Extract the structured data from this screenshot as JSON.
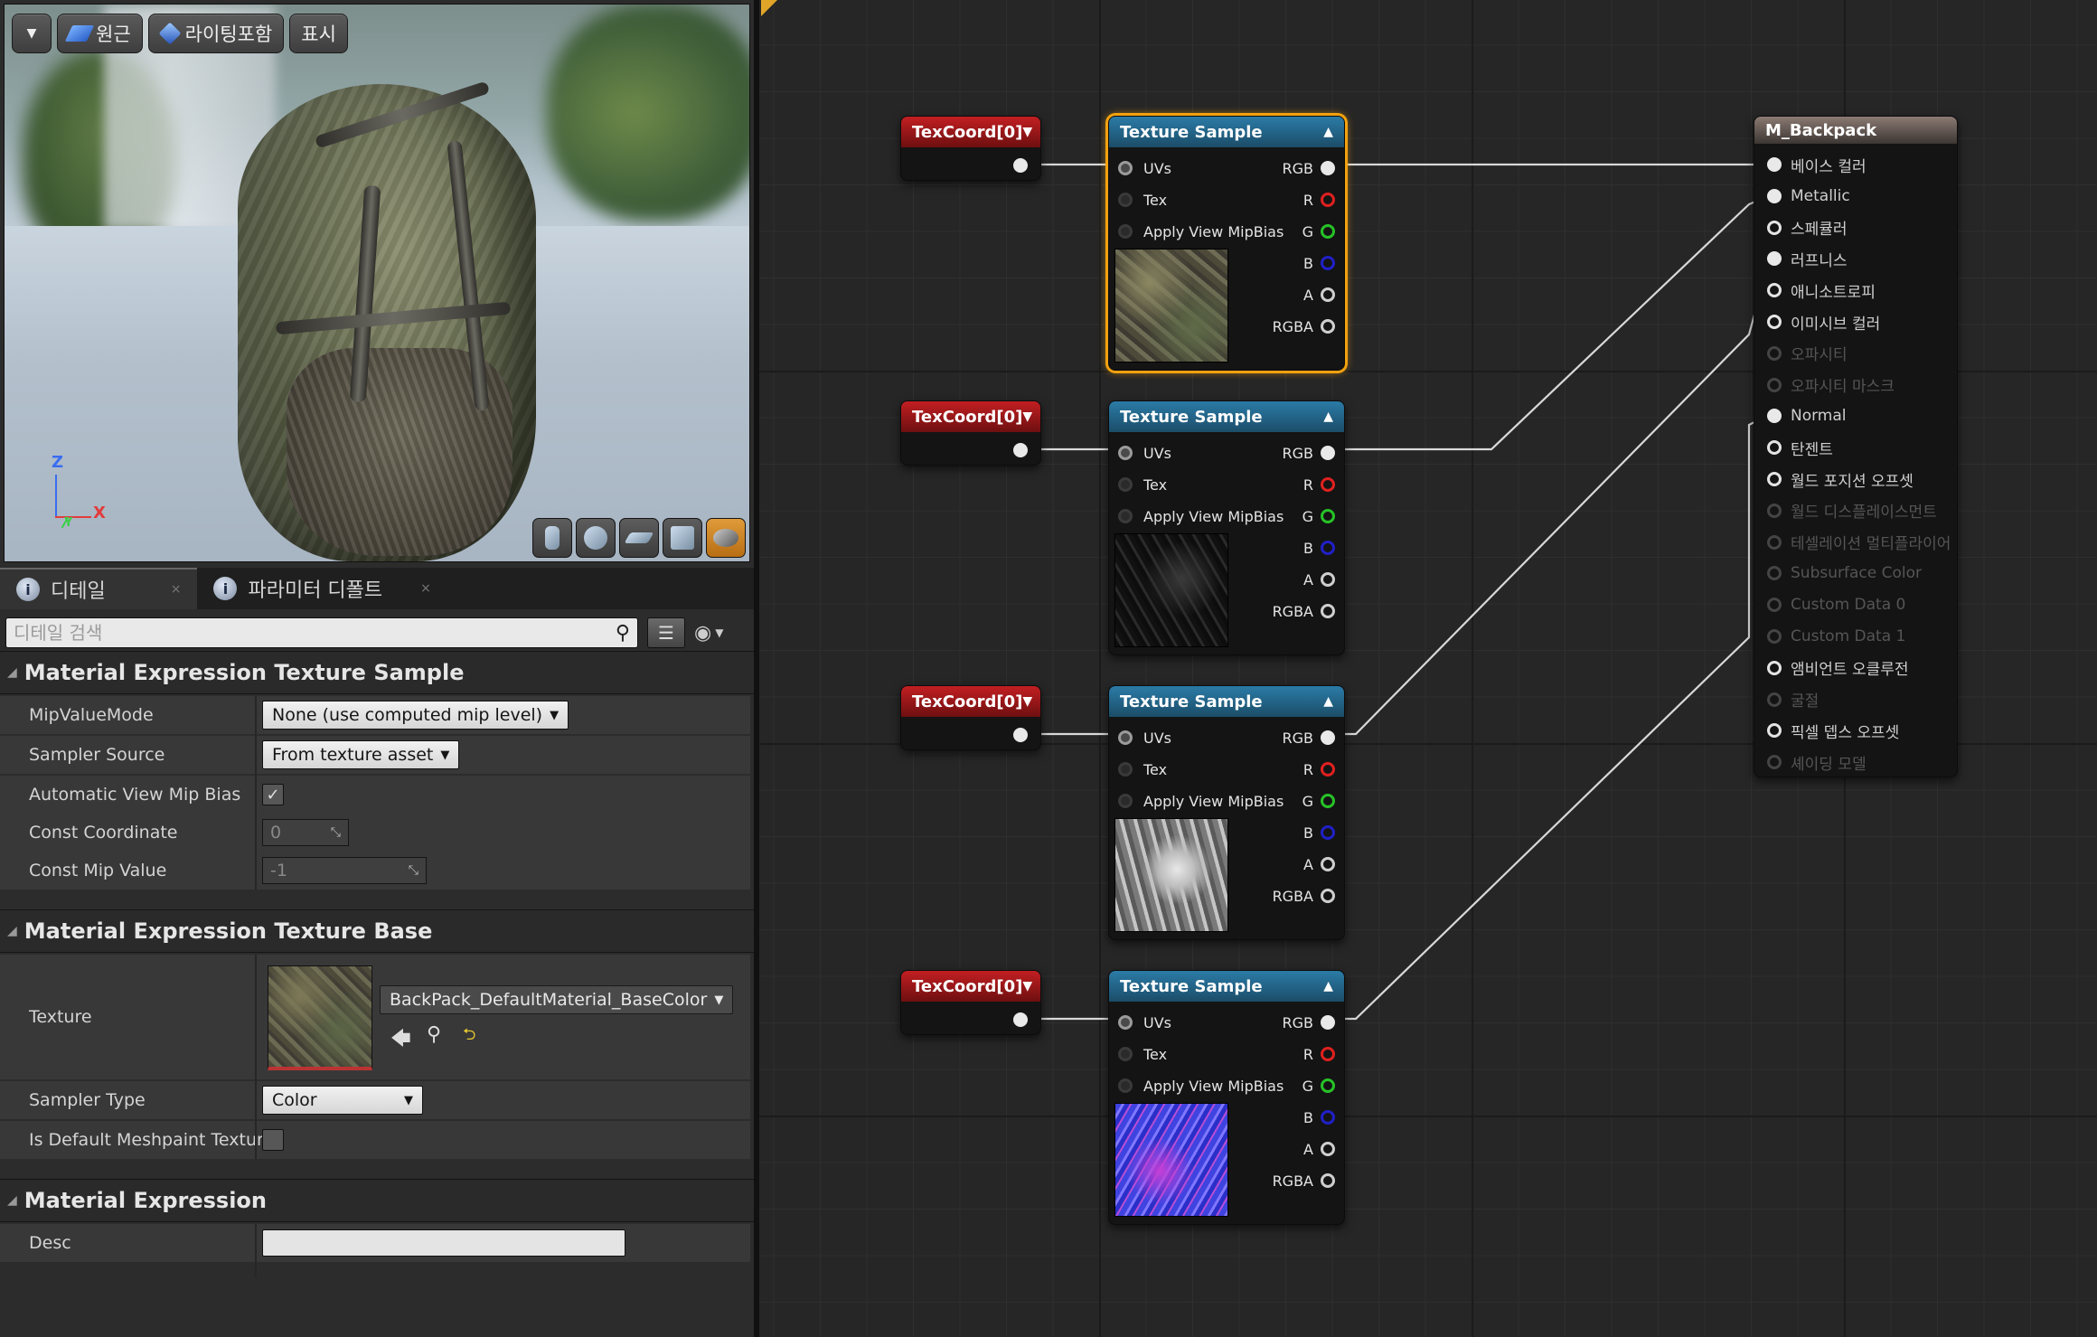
{
  "viewport": {
    "toolbar": {
      "menu_icon": "chevron-down-icon",
      "perspective_label": "원근",
      "lighting_label": "라이팅포함",
      "show_label": "표시"
    },
    "axes": {
      "z": "Z",
      "x": "X",
      "y": "Y"
    },
    "preview_tools": [
      "cylinder-icon",
      "sphere-icon",
      "plane-icon",
      "cube-icon",
      "teapot-icon"
    ]
  },
  "tabs": [
    {
      "label": "디테일",
      "icon": "info-icon",
      "active": true
    },
    {
      "label": "파라미터 디폴트",
      "icon": "info-icon",
      "active": false
    }
  ],
  "details": {
    "search_placeholder": "디테일 검색",
    "sections": {
      "texture_sample": {
        "title": "Material Expression Texture Sample",
        "mip_value_mode_label": "MipValueMode",
        "mip_value_mode_value": "None (use computed mip level)",
        "sampler_source_label": "Sampler Source",
        "sampler_source_value": "From texture asset",
        "auto_view_mip_bias_label": "Automatic View Mip Bias",
        "auto_view_mip_bias_checked": true,
        "const_coordinate_label": "Const Coordinate",
        "const_coordinate_value": "0",
        "const_mip_value_label": "Const Mip Value",
        "const_mip_value_value": "-1"
      },
      "texture_base": {
        "title": "Material Expression Texture Base",
        "texture_label": "Texture",
        "texture_asset": "BackPack_DefaultMaterial_BaseColor",
        "sampler_type_label": "Sampler Type",
        "sampler_type_value": "Color",
        "is_default_meshpaint_label": "Is Default Meshpaint Texture",
        "is_default_meshpaint_checked": false
      },
      "material_expression": {
        "title": "Material Expression",
        "desc_label": "Desc",
        "desc_value": ""
      }
    }
  },
  "graph": {
    "texcoord_label": "TexCoord[0]",
    "texture_sample_title": "Texture Sample",
    "texture_sample_pins": {
      "inputs": [
        "UVs",
        "Tex",
        "Apply View MipBias"
      ],
      "outputs": [
        "RGB",
        "R",
        "G",
        "B",
        "A",
        "RGBA"
      ]
    },
    "texture_samples": [
      {
        "preview": "base-color",
        "selected": true
      },
      {
        "preview": "metallic",
        "selected": false
      },
      {
        "preview": "roughness",
        "selected": false
      },
      {
        "preview": "normal",
        "selected": false
      }
    ],
    "material_node": {
      "title": "M_Backpack",
      "inputs": [
        {
          "label": "베이스 컬러",
          "enabled": true,
          "connected": true
        },
        {
          "label": "Metallic",
          "enabled": true,
          "connected": true
        },
        {
          "label": "스페큘러",
          "enabled": true,
          "connected": false
        },
        {
          "label": "러프니스",
          "enabled": true,
          "connected": true
        },
        {
          "label": "애니소트로피",
          "enabled": true,
          "connected": false
        },
        {
          "label": "이미시브 컬러",
          "enabled": true,
          "connected": false
        },
        {
          "label": "오파시티",
          "enabled": false,
          "connected": false
        },
        {
          "label": "오파시티 마스크",
          "enabled": false,
          "connected": false
        },
        {
          "label": "Normal",
          "enabled": true,
          "connected": true
        },
        {
          "label": "탄젠트",
          "enabled": true,
          "connected": false
        },
        {
          "label": "월드 포지션 오프셋",
          "enabled": true,
          "connected": false
        },
        {
          "label": "월드 디스플레이스먼트",
          "enabled": false,
          "connected": false
        },
        {
          "label": "테셀레이션 멀티플라이어",
          "enabled": false,
          "connected": false
        },
        {
          "label": "Subsurface Color",
          "enabled": false,
          "connected": false
        },
        {
          "label": "Custom Data 0",
          "enabled": false,
          "connected": false
        },
        {
          "label": "Custom Data 1",
          "enabled": false,
          "connected": false
        },
        {
          "label": "앰비언트 오클루전",
          "enabled": true,
          "connected": false
        },
        {
          "label": "굴절",
          "enabled": false,
          "connected": false
        },
        {
          "label": "픽셀 뎁스 오프셋",
          "enabled": true,
          "connected": false
        },
        {
          "label": "셰이딩 모델",
          "enabled": false,
          "connected": false
        }
      ]
    }
  },
  "colors": {
    "selection": "#f2a10f",
    "texcoord_header": "#c21f22",
    "texture_header": "#2b7ba7",
    "material_header": "#8a7a72"
  }
}
